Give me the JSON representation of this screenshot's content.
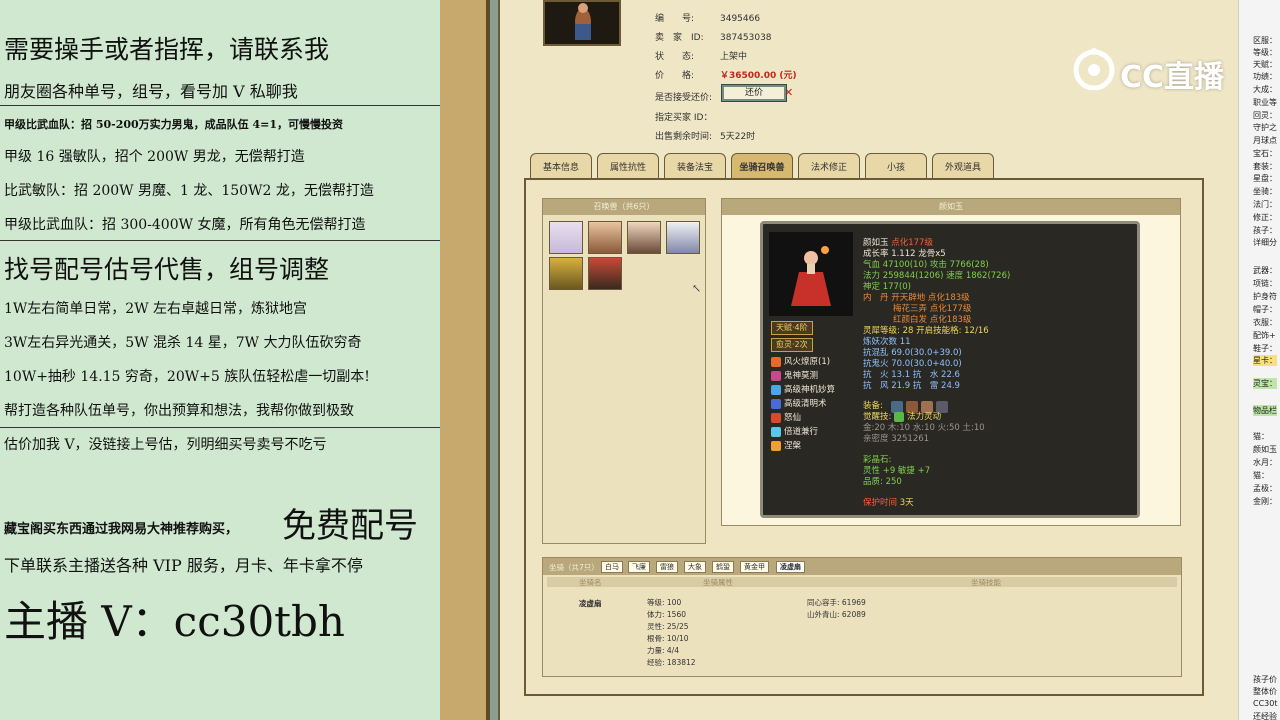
{
  "overlay": {
    "lines": [
      "需要操手或者指挥，请联系我",
      "朋友圈各种单号，组号，看号加 V 私聊我",
      "甲级比武血队：招 50-200万实力男鬼，成品队伍 4=1，可慢慢投资",
      "甲级 16 强敏队，招个 200W 男龙，无偿帮打造",
      "比武敏队：招 200W 男魔、1 龙、150W2 龙，无偿帮打造",
      "甲级比武血队：招 300-400W 女魔，所有角色无偿帮打造",
      "找号配号估号代售，组号调整",
      "1W左右简单日常，2W 左右卓越日常，炼狱地宫",
      "3W左右异光通关，5W 混杀 14 星，7W 大力队伍砍穷奇",
      "10W+抽秒 14.15 穷奇，20W+5 族队伍轻松虐一切副本!",
      "帮打造各种队伍单号，你出预算和想法，我帮你做到极致",
      "估价加我 V，没链接上号估，列明细买号卖号不吃亏",
      "藏宝阁买东西通过我网易大神推荐购买，",
      "免费配号",
      "下单联系主播送各种 VIP 服务，月卡、年卡拿不停",
      "主播 V：cc30tbh"
    ]
  },
  "listing": {
    "fields": [
      {
        "label": "编　　号:",
        "value": "3495466"
      },
      {
        "label": "卖　家　ID:",
        "value": "387453038"
      },
      {
        "label": "状　　态:",
        "value": "上架中"
      },
      {
        "label": "价　　格:",
        "value": "￥36500.00 (元)"
      },
      {
        "label": "是否接受还价:",
        "value": ""
      },
      {
        "label": "指定买家 ID：",
        "value": ""
      },
      {
        "label": "出售剩余时间:",
        "value": "5天22时"
      }
    ],
    "bargain_button": "还价"
  },
  "tabs": [
    "基本信息",
    "属性抗性",
    "装备法宝",
    "坐骑召唤兽",
    "法术修正",
    "小孩",
    "外观道具"
  ],
  "pet_list": {
    "header": "召唤兽（共6只）"
  },
  "pet_detail": {
    "header": "颜如玉",
    "name": "颜如玉",
    "name_suffix": "点化177级",
    "growth": "成长率 1.112  龙骨x5",
    "hp": "气血  47100(10)  攻击  7766(28)",
    "mp": "法力  259844(1206)  速度  1862(726)",
    "fixed": "神定  177(0)",
    "dan1": "内　丹  开天辟地  点化183级",
    "dan2": "梅花三弄  点化177级",
    "dan3": "红颜白发  点化183级",
    "spirit": "灵犀等级:  28  开启技能格:  12/16",
    "trans": "炼妖次数  11",
    "r1": "抗混乱  69.0(30.0+39.0)",
    "r2": "抗鬼火  70.0(30.0+40.0)",
    "r3": "抗　火  13.1  抗　水  22.6",
    "r4": "抗　风  21.9  抗　雷  24.9",
    "equip": "装备:",
    "awaken": "觉醒技:",
    "awaken_skill": "法力灵动",
    "elements": "金:20  木:10  水:10  火:50  土:10",
    "intimacy": "亲密度  3251261",
    "color_crystal": "彩晶石:",
    "cc_attr": "灵性 +9  敏捷 +7",
    "quality": "品质:  250",
    "protect": "保护时间",
    "protect_days": "3天",
    "badge1": "天赋·4阶",
    "badge2": "愈灵·2次",
    "skills": [
      "风火燎原(1)",
      "鬼神莫测",
      "高级神机妙算",
      "高级清明术",
      "怒仙",
      "倍道兼行",
      "涅槃"
    ]
  },
  "mount": {
    "header": "坐骑（共7只）",
    "tabs": [
      "白马",
      "飞廉",
      "雷狼",
      "大象",
      "鹤蛩",
      "黄金甲",
      "凌虚扇"
    ],
    "col1": "坐骑名",
    "col2": "坐骑属性",
    "col3": "坐骑技能",
    "name": "凌虚扇",
    "attrs": [
      "等级:  100",
      "体力:  1560",
      "灵性:  25/25",
      "根骨:  10/10",
      "力量:  4/4",
      "经验:  183812"
    ],
    "skills": [
      "同心容手:  61969",
      "山外青山:  62089"
    ]
  },
  "right_strip": [
    "区服：",
    "等级：",
    "天赋：",
    "功绩：",
    "大成：",
    "职业等",
    "回灵：",
    "守护之",
    "月球点",
    "宝石：",
    "套装：",
    "星盘：",
    "坐骑：",
    "法门：",
    "修正：",
    "孩子：",
    "详细分",
    "武器：",
    "项链：",
    "护身符",
    "帽子：",
    "衣服：",
    "配饰+",
    "鞋子：",
    "星卡：",
    "灵宝：",
    "物品栏",
    "猫：",
    "颜如玉",
    "水月：",
    "猫：",
    "孟极：",
    "金刚：",
    "孩子价",
    "整体价",
    "CC30t",
    "还经验"
  ],
  "logo_text": "CC直播",
  "colors": {
    "overlay_bg": "#cfe8cf",
    "price": "#c0261c",
    "card_bg": "#2a2822"
  }
}
